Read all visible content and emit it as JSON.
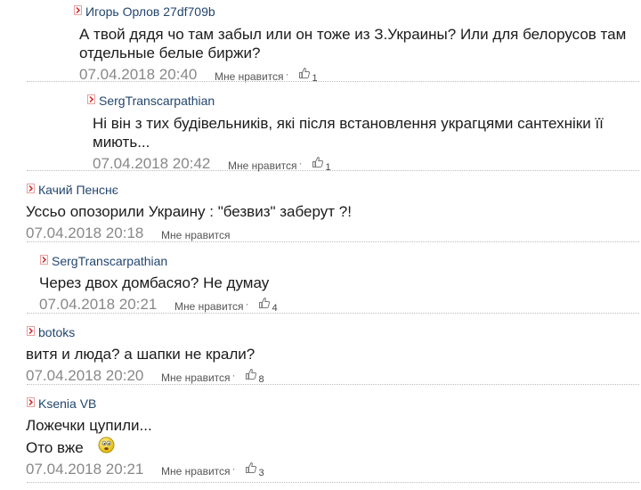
{
  "comments": [
    {
      "author": "Игорь Орлов 27df709b",
      "lines": [
        "А твой дядя чо там забыл или он тоже из З.Украины? Или для белорусов там",
        "отдельные белые биржи?"
      ],
      "date": "07.04.2018 20:40",
      "like_label": "Мне нравится",
      "likes": "1"
    },
    {
      "author": "SergTranscarpathian",
      "lines": [
        "Ні він з тих будівельників, які після встановлення украгцями сантехніки її",
        "миють..."
      ],
      "date": "07.04.2018 20:42",
      "like_label": "Мне нравится",
      "likes": "1"
    },
    {
      "author": "Качий Пенснє",
      "lines": [
        "Уссьо опозорили Украину : \"безвиз\" заберут ?!"
      ],
      "date": "07.04.2018 20:18",
      "like_label": "Мне нравится",
      "likes": ""
    },
    {
      "author": "SergTranscarpathian",
      "lines": [
        "Через двох домбасяо? Не думау"
      ],
      "date": "07.04.2018 20:21",
      "like_label": "Мне нравится",
      "likes": "4"
    },
    {
      "author": "botoks",
      "lines": [
        "витя и люда? а шапки не крали?"
      ],
      "date": "07.04.2018 20:20",
      "like_label": "Мне нравится",
      "likes": "8"
    },
    {
      "author": "Ksenia VB",
      "lines": [
        "Ложечки цупили...",
        "Ото вже"
      ],
      "date": "07.04.2018 20:21",
      "like_label": "Мне нравится",
      "likes": "3"
    }
  ],
  "icons": {
    "author_marker": "arrow-right-icon",
    "like": "thumbs-up-icon",
    "emoji": "smiley-icon"
  },
  "colors": {
    "author": "#23466e",
    "date": "#888888",
    "marker": "#d8262a"
  }
}
